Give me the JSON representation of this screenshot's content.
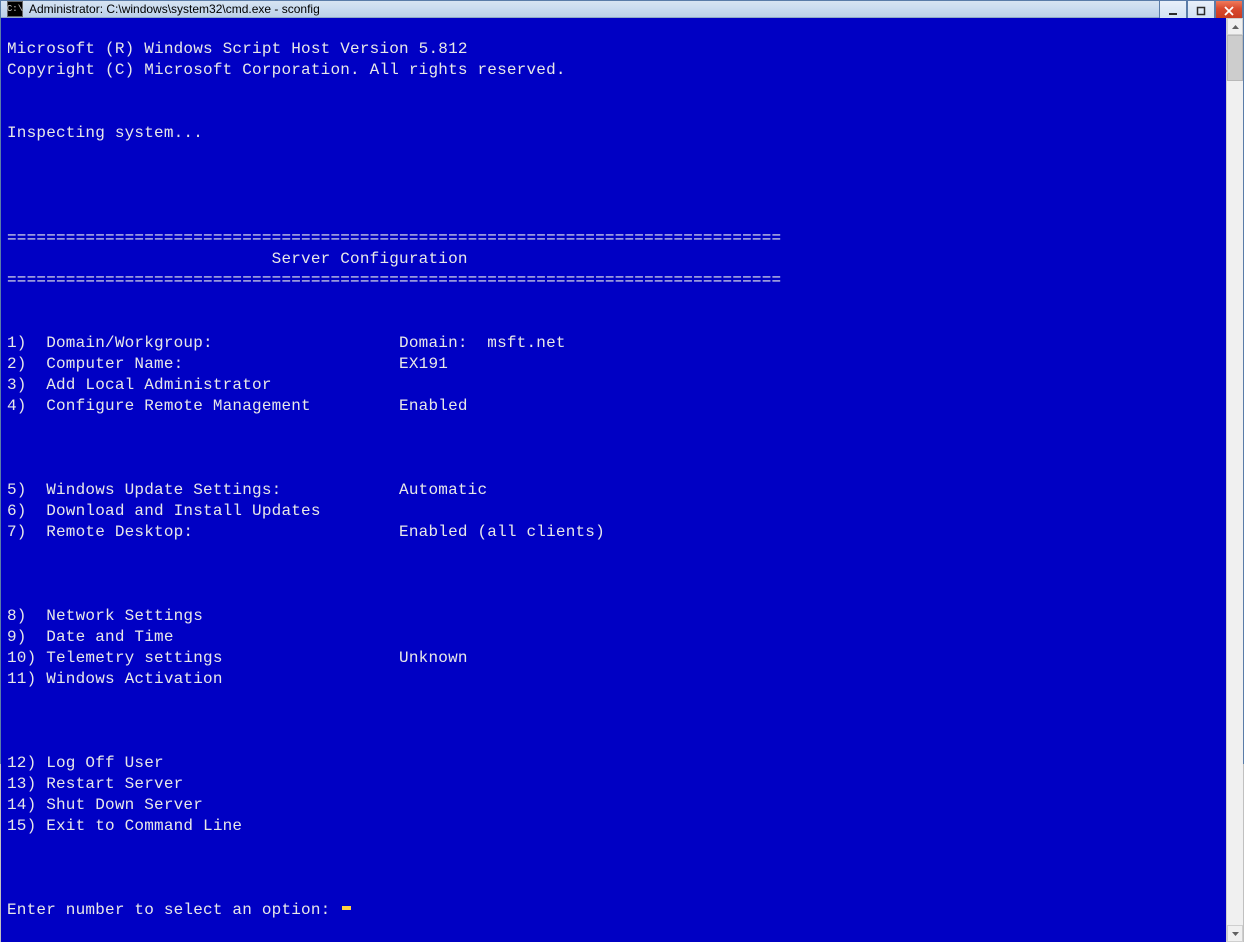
{
  "window": {
    "title": "Administrator: C:\\windows\\system32\\cmd.exe - sconfig"
  },
  "header": {
    "line1": "Microsoft (R) Windows Script Host Version 5.812",
    "line2": "Copyright (C) Microsoft Corporation. All rights reserved."
  },
  "inspecting": "Inspecting system...",
  "divider": "===============================================================================",
  "banner_title": "                           Server Configuration",
  "menu": {
    "group1": [
      {
        "num": "1)",
        "label": "Domain/Workgroup:",
        "value": "Domain:  msft.net"
      },
      {
        "num": "2)",
        "label": "Computer Name:",
        "value": "EX191"
      },
      {
        "num": "3)",
        "label": "Add Local Administrator",
        "value": ""
      },
      {
        "num": "4)",
        "label": "Configure Remote Management",
        "value": "Enabled"
      }
    ],
    "group2": [
      {
        "num": "5)",
        "label": "Windows Update Settings:",
        "value": "Automatic"
      },
      {
        "num": "6)",
        "label": "Download and Install Updates",
        "value": ""
      },
      {
        "num": "7)",
        "label": "Remote Desktop:",
        "value": "Enabled (all clients)"
      }
    ],
    "group3": [
      {
        "num": "8)",
        "label": "Network Settings",
        "value": ""
      },
      {
        "num": "9)",
        "label": "Date and Time",
        "value": ""
      },
      {
        "num": "10)",
        "label": "Telemetry settings",
        "value": "Unknown"
      },
      {
        "num": "11)",
        "label": "Windows Activation",
        "value": ""
      }
    ],
    "group4": [
      {
        "num": "12)",
        "label": "Log Off User",
        "value": ""
      },
      {
        "num": "13)",
        "label": "Restart Server",
        "value": ""
      },
      {
        "num": "14)",
        "label": "Shut Down Server",
        "value": ""
      },
      {
        "num": "15)",
        "label": "Exit to Command Line",
        "value": ""
      }
    ]
  },
  "prompt": "Enter number to select an option: "
}
